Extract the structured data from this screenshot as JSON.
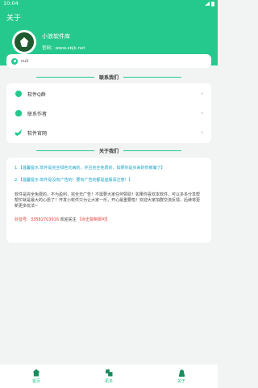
{
  "status_bar": {
    "time": "10:04"
  },
  "header": {
    "title": "关于",
    "app_name": "小浪软件库",
    "website": "官网：www.xbjk.net"
  },
  "notice": {
    "text": "null"
  },
  "contact_section": {
    "title": "联系我们",
    "items": [
      {
        "label": "软件Q群",
        "icon": "facebook-icon"
      },
      {
        "label": "联系作者",
        "icon": "weibo-icon"
      },
      {
        "label": "软件官网",
        "icon": "twitter-icon"
      }
    ]
  },
  "about_section": {
    "title": "关于我们",
    "tip1": "1.【温馨提示:软件是完全绿色无病的，并且完全免费的，如果你是买来的你被骗了】",
    "tip2": "2.【温馨提示:软件是没有广告的！要有广告的都是盗版请注意！】",
    "body": "软件是完全免费的，不为盈利，完全无广告！不需要大家任何赞助！如果你喜欢本软件，可以多多分享帮帮忙就是最大的心愿了！开发小软件只为让大家一乐，开心最重要啦！欢迎大家加群交流反馈，后续将更新更多玩法~",
    "douyin_label": "抖音号：",
    "douyin_id": "33582703916",
    "douyin_follow": "欢迎关注",
    "douyin_copy": "【点击复制即可】"
  },
  "tabbar": {
    "tabs": [
      {
        "label": "首页",
        "icon": "home-icon"
      },
      {
        "label": "更多",
        "icon": "more-icon"
      },
      {
        "label": "关于",
        "icon": "user-icon"
      }
    ]
  },
  "colors": {
    "accent": "#26c98d",
    "tip": "#1aa3c9",
    "highlight": "#e53935"
  }
}
